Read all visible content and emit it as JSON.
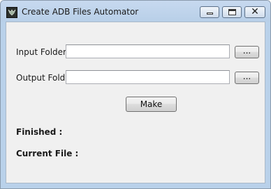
{
  "window": {
    "title": "Create ADB Files Automator",
    "controls": {
      "minimize_icon": "minimize-icon",
      "maximize_icon": "maximize-icon",
      "close_icon": "close-icon",
      "close_glyph": "✕"
    }
  },
  "form": {
    "input_folder": {
      "label": "Input Folder",
      "value": "",
      "browse_label": "..."
    },
    "output_folder": {
      "label": "Output Folder",
      "value": "",
      "browse_label": "..."
    },
    "make_label": "Make",
    "finished_label": "Finished :",
    "current_file_label": "Current File :"
  },
  "colors": {
    "frame": "#b9d1ea",
    "client_background": "#f0f0f0"
  }
}
